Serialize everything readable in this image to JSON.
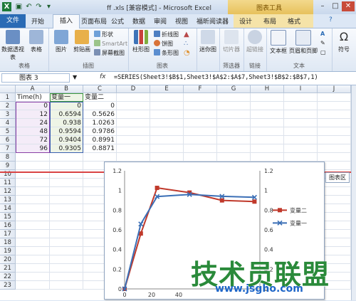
{
  "window": {
    "title": "ff .xls [兼容模式] - Microsoft Excel",
    "context_band": "图表工具"
  },
  "tabs": {
    "file": "文件",
    "items": [
      "开始",
      "插入",
      "页面布局",
      "公式",
      "数据",
      "审阅",
      "视图",
      "福昕阅读器",
      "设计",
      "布局",
      "格式"
    ]
  },
  "ribbon": {
    "groups": {
      "tables": {
        "label": "表格",
        "buttons": [
          "数据透视表",
          "表格"
        ]
      },
      "illustrations": {
        "label": "插图",
        "buttons": [
          "图片",
          "剪贴画"
        ],
        "small": [
          "形状",
          "SmartArt",
          "屏幕截图"
        ]
      },
      "charts": {
        "label": "图表",
        "buttons": [
          "柱形图"
        ],
        "small": [
          "折线图",
          "饼图",
          "条形图"
        ]
      },
      "sparklines": {
        "label": "",
        "buttons": [
          "迷你图"
        ]
      },
      "filter": {
        "label": "筛选器",
        "buttons": [
          "切片器"
        ]
      },
      "links": {
        "label": "链接",
        "buttons": [
          "超链接"
        ]
      },
      "text": {
        "label": "文本",
        "buttons": [
          "文本框",
          "页眉和页脚"
        ]
      },
      "symbols": {
        "label": "",
        "buttons": [
          "符号"
        ]
      }
    }
  },
  "formula_bar": {
    "name_box": "图表 3",
    "fx": "fx",
    "formula": "=SERIES(Sheet3!$B$1,Sheet3!$A$2:$A$7,Sheet3!$B$2:$B$7,1)"
  },
  "sheet": {
    "columns": [
      "A",
      "B",
      "C",
      "D",
      "E",
      "F",
      "G",
      "H",
      "I",
      "J"
    ],
    "rows": [
      "1",
      "2",
      "3",
      "4",
      "5",
      "6",
      "7",
      "8",
      "9",
      "10",
      "11",
      "12",
      "13",
      "14",
      "15",
      "16",
      "17",
      "18",
      "19",
      "20",
      "21",
      "22",
      "23"
    ],
    "header": [
      "Time(h)",
      "变量一",
      "变量二"
    ],
    "data": [
      [
        "0",
        "0",
        "0"
      ],
      [
        "12",
        "0.6594",
        "0.5626"
      ],
      [
        "24",
        "0.938",
        "1.0263"
      ],
      [
        "48",
        "0.9594",
        "0.9786"
      ],
      [
        "72",
        "0.9404",
        "0.8991"
      ],
      [
        "96",
        "0.9305",
        "0.8871"
      ]
    ]
  },
  "chart_data": {
    "type": "line",
    "x": [
      0,
      12,
      24,
      48,
      72,
      96
    ],
    "x_ticks": [
      "0",
      "20",
      "40"
    ],
    "y_ticks_left": [
      "0",
      "0.2",
      "0.4",
      "0.6",
      "0.8",
      "1",
      "1.2"
    ],
    "y_ticks_right": [
      "0",
      "0.2",
      "0.4",
      "0.6",
      "0.8",
      "1",
      "1.2"
    ],
    "ylim": [
      0,
      1.2
    ],
    "series": [
      {
        "name": "变量二",
        "values": [
          0,
          0.5626,
          1.0263,
          0.9786,
          0.8991,
          0.8871
        ],
        "color": "#c0392b"
      },
      {
        "name": "变量一",
        "values": [
          0,
          0.6594,
          0.938,
          0.9594,
          0.9404,
          0.9305
        ],
        "color": "#3b6fb6"
      }
    ],
    "legend_position": "right",
    "tooltip": "图表区"
  },
  "watermark": {
    "text": "技术员联盟",
    "url": "www.jsgho.com",
    "color": "#2a8a3a"
  },
  "colors": {
    "accent": "#2a6bb5",
    "excel_green": "#1d5f2e"
  }
}
